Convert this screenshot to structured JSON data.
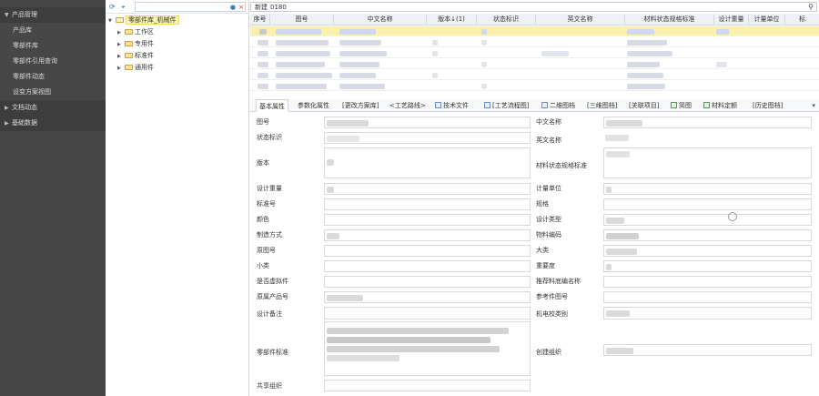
{
  "nav": {
    "groups": [
      {
        "label": "产品管理",
        "expanded": true
      },
      {
        "label": "文档动态",
        "expanded": false
      },
      {
        "label": "基础数据",
        "expanded": false
      }
    ],
    "items": [
      {
        "label": "产品库",
        "active": false
      },
      {
        "label": "零部件库",
        "active": true
      },
      {
        "label": "零部件引用查询",
        "active": false
      },
      {
        "label": "零部件动态",
        "active": false
      },
      {
        "label": "设变方案视图",
        "active": false
      }
    ]
  },
  "tree": {
    "search_value": "",
    "nodes": [
      {
        "label": "零部件库_机械件",
        "selected": true,
        "expanded": true
      },
      {
        "label": "工作区",
        "selected": false,
        "expanded": false
      },
      {
        "label": "专用件",
        "selected": false,
        "expanded": false
      },
      {
        "label": "标准件",
        "selected": false,
        "expanded": false
      },
      {
        "label": "通用件",
        "selected": false,
        "expanded": false
      }
    ]
  },
  "search": {
    "label": "新建",
    "value": "0180"
  },
  "grid": {
    "columns": [
      "序号",
      "图号",
      "中文名称",
      "版本↓(1)",
      "状态标识",
      "英文名称",
      "材料状态规格标准",
      "设计重量",
      "计量单位",
      "标"
    ],
    "selected_row_index": 0
  },
  "tabs": [
    {
      "label": "基本属性",
      "active": true
    },
    {
      "label": "参数化属性",
      "active": false
    },
    {
      "label": "[更改方案库]",
      "active": false
    },
    {
      "label": "<工艺路线>",
      "active": false
    },
    {
      "label": "技术文件",
      "active": false
    },
    {
      "label": "[工艺流程图]",
      "active": false
    },
    {
      "label": "二维图档",
      "active": false
    },
    {
      "label": "[三维图档]",
      "active": false
    },
    {
      "label": "[关联项目]",
      "active": false
    },
    {
      "label": "简图",
      "active": false
    },
    {
      "label": "材料定额",
      "active": false
    },
    {
      "label": "[历史图档]",
      "active": false
    }
  ],
  "form": {
    "left_labels": [
      "图号",
      "状态标识",
      "版本",
      "设计重量",
      "标准号",
      "颜色",
      "制造方式",
      "原图号",
      "小类",
      "是否虚拟件",
      "原属产品号",
      "设计备注",
      "零部件标准",
      "共享组织"
    ],
    "right_labels": [
      "中文名称",
      "英文名称",
      "材料状态规格标准",
      "计量单位",
      "规格",
      "设计类型",
      "物料编码",
      "大类",
      "重要度",
      "推荐料底编名称",
      "参考件图号",
      "机电校类别",
      "创建组织"
    ]
  }
}
